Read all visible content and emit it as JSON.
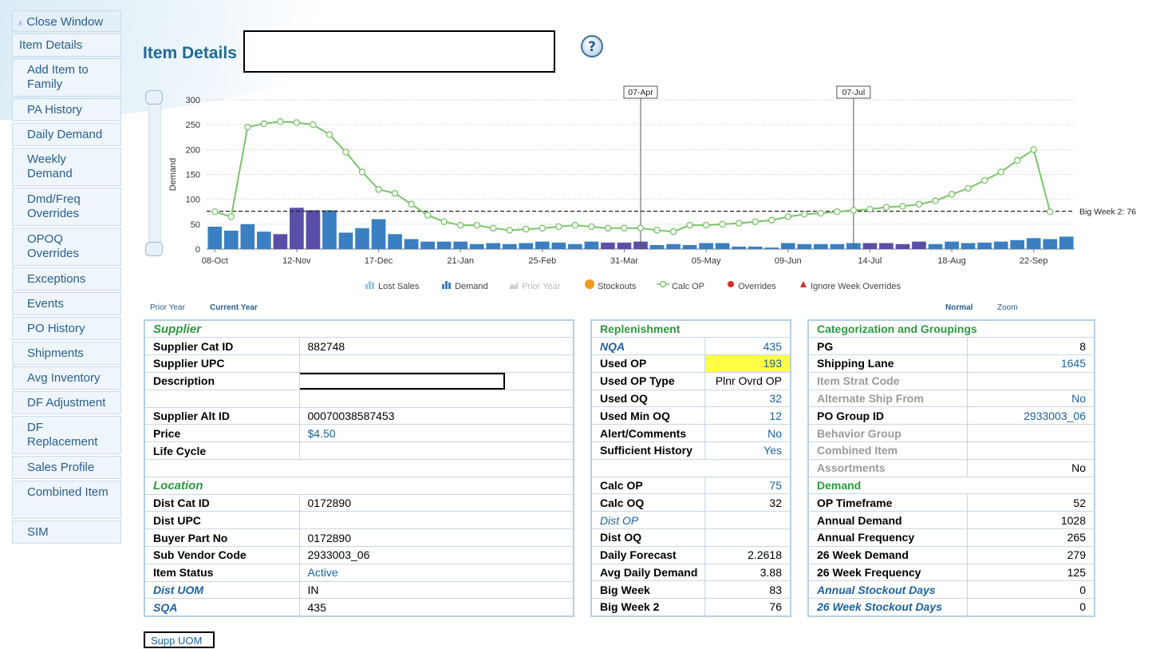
{
  "sidebar": {
    "items": [
      {
        "label": "Close Window"
      },
      {
        "label": "Item Details"
      },
      {
        "label": "Add Item to Family"
      },
      {
        "label": "PA History"
      },
      {
        "label": "Daily Demand"
      },
      {
        "label": "Weekly Demand"
      },
      {
        "label": "Dmd/Freq Overrides"
      },
      {
        "label": "OPOQ Overrides"
      },
      {
        "label": "Exceptions"
      },
      {
        "label": "Events"
      },
      {
        "label": "PO History"
      },
      {
        "label": "Shipments"
      },
      {
        "label": "Avg Inventory"
      },
      {
        "label": "DF Adjustment"
      },
      {
        "label": "DF Replacement"
      },
      {
        "label": "Sales Profile"
      },
      {
        "label": "Combined Item"
      },
      {
        "label": "SIM"
      }
    ]
  },
  "header": {
    "title": "Item Details",
    "help_icon": "question-circle-icon"
  },
  "chart_controls": {
    "prior_year": "Prior Year",
    "current_year": "Current Year",
    "normal": "Normal",
    "zoom": "Zoom"
  },
  "chart_data": {
    "type": "bar+line",
    "ylabel": "Demand",
    "ylim": [
      0,
      300
    ],
    "yticks": [
      0,
      50,
      100,
      150,
      200,
      250,
      300
    ],
    "xtick_labels": [
      "08-Oct",
      "12-Nov",
      "17-Dec",
      "21-Jan",
      "25-Feb",
      "31-Mar",
      "05-May",
      "09-Jun",
      "14-Jul",
      "18-Aug",
      "22-Sep"
    ],
    "markers": [
      {
        "label": "07-Apr",
        "week": 26
      },
      {
        "label": "07-Jul",
        "week": 39
      }
    ],
    "reference_line": {
      "label": "Big Week 2: 76",
      "value": 76
    },
    "legend": [
      "Lost Sales",
      "Demand",
      "Prior Year",
      "Stockouts",
      "Calc OP",
      "Overrides",
      "Ignore Week Overrides"
    ],
    "colors": {
      "demand": "#3a7fc1",
      "override": "#5a4fa8",
      "calc_op": "#7bc46a",
      "stockout": "#f39a1e",
      "overrides_dot": "#d0312d",
      "ignore": "#d0312d"
    },
    "series": [
      {
        "name": "Demand",
        "values": [
          45,
          37,
          50,
          35,
          30,
          83,
          78,
          78,
          33,
          42,
          60,
          30,
          20,
          15,
          15,
          15,
          10,
          12,
          10,
          12,
          15,
          13,
          10,
          15,
          13,
          13,
          15,
          8,
          10,
          8,
          12,
          12,
          5,
          5,
          3,
          12,
          10,
          10,
          10,
          12,
          12,
          12,
          10,
          15,
          10,
          15,
          12,
          13,
          15,
          18,
          22,
          20,
          25
        ],
        "override_weeks": [
          4,
          5,
          6,
          24,
          25,
          26,
          40,
          41,
          42,
          43
        ]
      },
      {
        "name": "Calc OP",
        "values": [
          75,
          65,
          245,
          252,
          256,
          254,
          250,
          230,
          195,
          155,
          120,
          112,
          90,
          68,
          55,
          48,
          48,
          42,
          38,
          40,
          42,
          45,
          48,
          45,
          42,
          42,
          42,
          38,
          35,
          48,
          48,
          50,
          52,
          55,
          58,
          65,
          70,
          72,
          75,
          78,
          80,
          84,
          86,
          90,
          97,
          110,
          122,
          138,
          155,
          178,
          200,
          75
        ]
      }
    ]
  },
  "supplier": {
    "title": "Supplier",
    "rows": [
      {
        "label": "Supplier Cat ID",
        "value": "882748"
      },
      {
        "label": "Supplier UPC",
        "value": ""
      },
      {
        "label": "Description",
        "value": ""
      },
      {
        "label": "",
        "value": ""
      },
      {
        "label": "Supplier Alt ID",
        "value": "00070038587453"
      },
      {
        "label": "Price",
        "value": "$4.50"
      },
      {
        "label": "Life Cycle",
        "value": ""
      },
      {
        "label": "",
        "value": ""
      }
    ]
  },
  "location": {
    "title": "Location",
    "rows": [
      {
        "label": "Dist Cat ID",
        "value": "0172890"
      },
      {
        "label": "Dist UPC",
        "value": ""
      },
      {
        "label": "Buyer Part No",
        "value": "0172890"
      },
      {
        "label": "Sub Vendor Code",
        "value": "2933003_06"
      },
      {
        "label": "Item Status",
        "value": "Active"
      },
      {
        "label": "Dist UOM",
        "value": "IN"
      },
      {
        "label": "SQA",
        "value": "435"
      }
    ]
  },
  "replenishment": {
    "title": "Replenishment",
    "rows": [
      {
        "label": "NQA",
        "value": "435"
      },
      {
        "label": "Used OP",
        "value": "193"
      },
      {
        "label": "Used OP Type",
        "value": "Plnr Ovrd OP"
      },
      {
        "label": "Used OQ",
        "value": "32"
      },
      {
        "label": "Used Min OQ",
        "value": "12"
      },
      {
        "label": "Alert/Comments",
        "value": "No"
      },
      {
        "label": "Sufficient History",
        "value": "Yes"
      },
      {
        "label": "",
        "value": ""
      },
      {
        "label": "Calc OP",
        "value": "75"
      },
      {
        "label": "Calc OQ",
        "value": "32"
      },
      {
        "label": "Dist OP",
        "value": ""
      },
      {
        "label": "Dist OQ",
        "value": ""
      },
      {
        "label": "Daily Forecast",
        "value": "2.2618"
      },
      {
        "label": "Avg Daily Demand",
        "value": "3.88"
      },
      {
        "label": "Big Week",
        "value": "83"
      },
      {
        "label": "Big Week 2",
        "value": "76"
      }
    ]
  },
  "categorization": {
    "title": "Categorization and Groupings",
    "rows": [
      {
        "label": "PG",
        "value": "8"
      },
      {
        "label": "Shipping Lane",
        "value": "1645"
      },
      {
        "label": "Item Strat Code",
        "value": ""
      },
      {
        "label": "Alternate Ship From",
        "value": "No"
      },
      {
        "label": "PO Group ID",
        "value": "2933003_06"
      },
      {
        "label": "Behavior Group",
        "value": ""
      },
      {
        "label": "Combined Item",
        "value": ""
      },
      {
        "label": "Assortments",
        "value": "No"
      }
    ]
  },
  "demand": {
    "title": "Demand",
    "rows": [
      {
        "label": "OP Timeframe",
        "value": "52"
      },
      {
        "label": "Annual Demand",
        "value": "1028"
      },
      {
        "label": "Annual Frequency",
        "value": "265"
      },
      {
        "label": "26 Week Demand",
        "value": "279"
      },
      {
        "label": "26 Week Frequency",
        "value": "125"
      },
      {
        "label": "Annual Stockout Days",
        "value": "0"
      },
      {
        "label": "26 Week Stockout Days",
        "value": "0"
      }
    ]
  },
  "footer": {
    "supp_uom": "Supp UOM"
  }
}
